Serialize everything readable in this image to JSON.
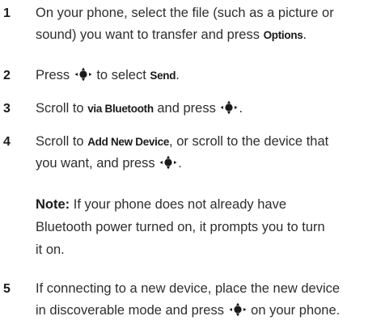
{
  "steps": [
    {
      "number": "1",
      "line1_a": "On your phone, select the file (such as a picture or",
      "line2_a": "sound) you want to transfer and press ",
      "line2_cmd": "Options",
      "line2_b": "."
    },
    {
      "number": "2",
      "text_a": "Press ",
      "text_b": " to select ",
      "cmd": "Send",
      "text_c": "."
    },
    {
      "number": "3",
      "text_a": "Scroll to ",
      "cmd": "via Bluetooth",
      "text_b": " and press ",
      "text_c": "."
    },
    {
      "number": "4",
      "line1_a": "Scroll to ",
      "line1_cmd": "Add New Device",
      "line1_b": ", or scroll to the device that",
      "line2_a": "you want, and press ",
      "line2_b": "."
    },
    {
      "number": "5",
      "line1": "If connecting to a new device, place the new device",
      "line2_a": "in discoverable mode and press ",
      "line2_b": " on your phone."
    }
  ],
  "note": {
    "label": "Note:",
    "line1": " If your phone does not already have",
    "line2": "Bluetooth power turned on, it prompts you to turn",
    "line3": "it on."
  },
  "icons": {
    "nav_key": "navigation-key-icon"
  },
  "colors": {
    "text": "#2e2e2e",
    "emphasis": "#1a1a1a"
  }
}
